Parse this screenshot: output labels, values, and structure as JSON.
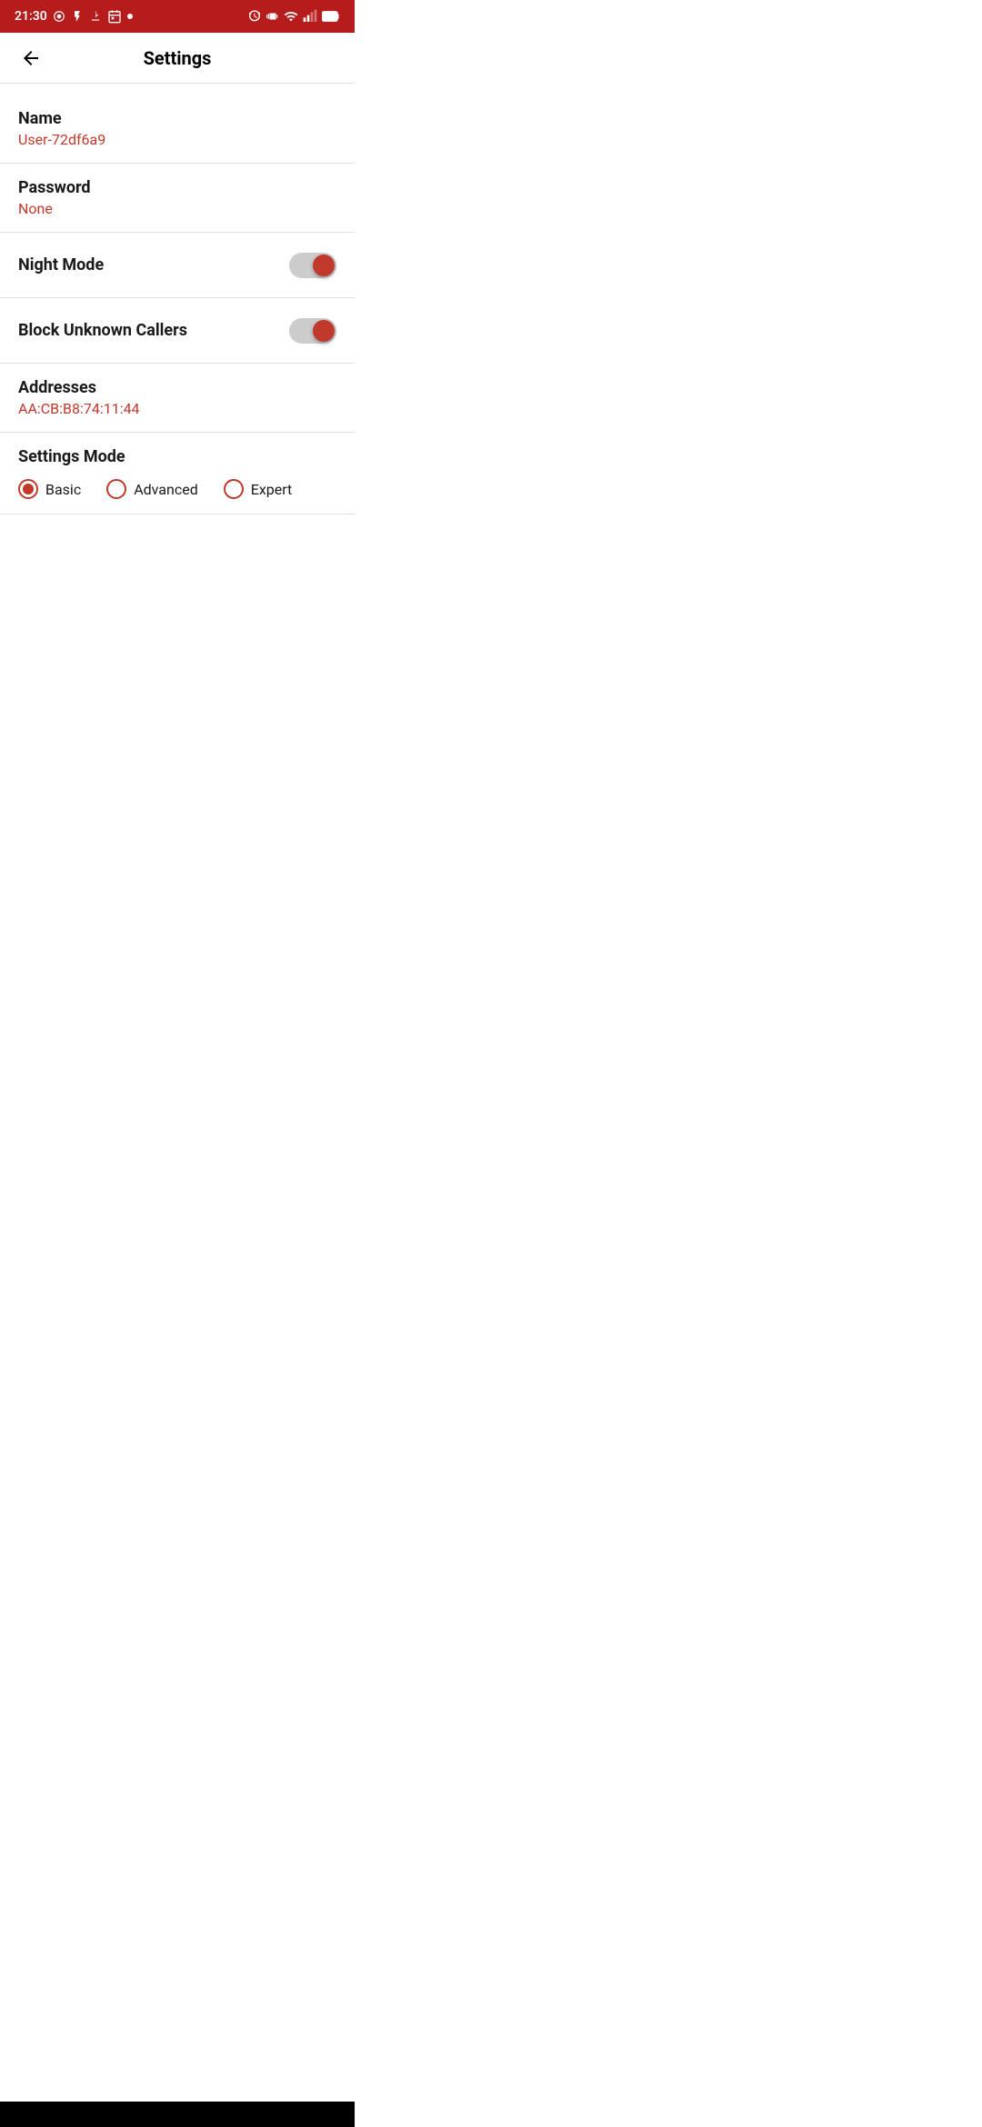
{
  "statusBar": {
    "time": "21:30",
    "icons": [
      "location",
      "flash",
      "download",
      "calendar",
      "dot"
    ]
  },
  "appBar": {
    "title": "Settings",
    "backLabel": "Back"
  },
  "settings": {
    "name": {
      "label": "Name",
      "value": "User-72df6a9"
    },
    "password": {
      "label": "Password",
      "value": "None"
    },
    "nightMode": {
      "label": "Night Mode",
      "enabled": true
    },
    "blockUnknownCallers": {
      "label": "Block Unknown Callers",
      "enabled": true
    },
    "addresses": {
      "label": "Addresses",
      "value": "AA:CB:B8:74:11:44"
    },
    "settingsMode": {
      "label": "Settings Mode",
      "options": [
        "Basic",
        "Advanced",
        "Expert"
      ],
      "selected": "Basic"
    }
  },
  "homeIndicator": {
    "color": "#ffffff"
  }
}
